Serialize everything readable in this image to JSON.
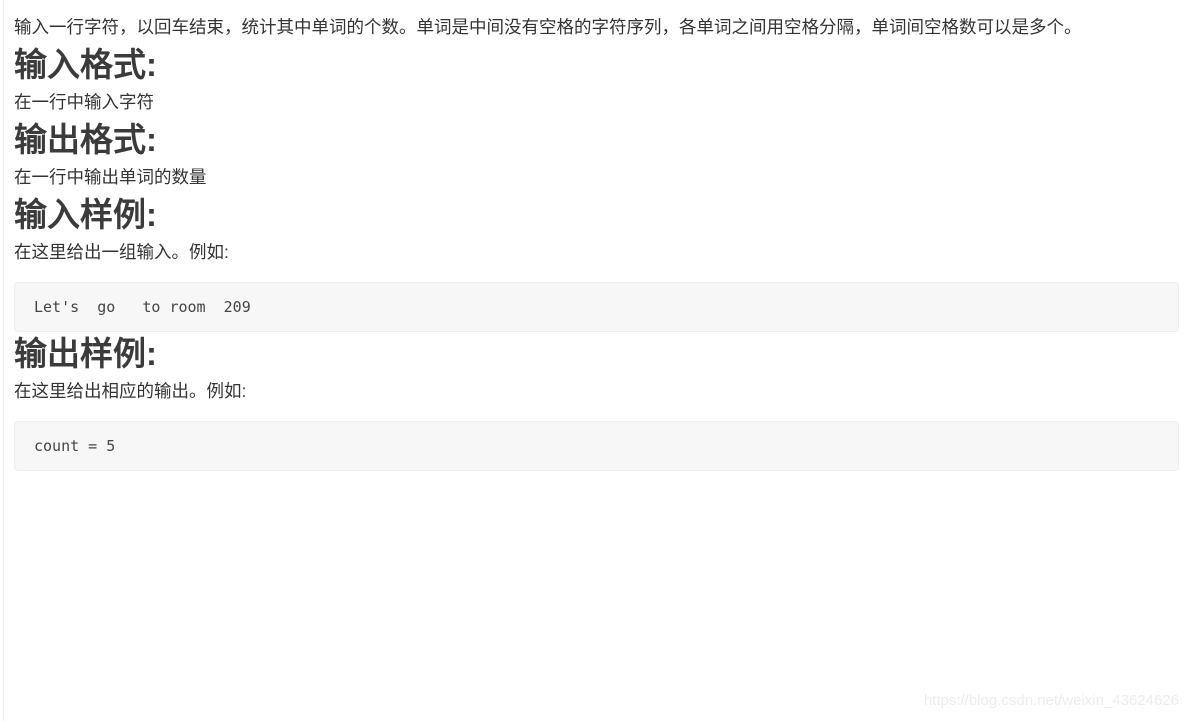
{
  "document": {
    "intro_paragraph": "输入一行字符，以回车结束，统计其中单词的个数。单词是中间没有空格的字符序列，各单词之间用空格分隔，单词间空格数可以是多个。",
    "sections": [
      {
        "heading": "输入格式:",
        "paragraph": "在一行中输入字符"
      },
      {
        "heading": "输出格式:",
        "paragraph": "在一行中输出单词的数量"
      },
      {
        "heading": "输入样例:",
        "paragraph": "在这里给出一组输入。例如:",
        "code": "Let's  go   to room  209"
      },
      {
        "heading": "输出样例:",
        "paragraph": "在这里给出相应的输出。例如:",
        "code": "count = 5"
      }
    ]
  },
  "watermark": {
    "text": "https://blog.csdn.net/weixin_43624626"
  },
  "colors": {
    "body_text": "#333333",
    "heading_text": "#3b3b3b",
    "code_background": "#f7f7f7",
    "code_border": "#eeeeee",
    "code_text": "#444444",
    "watermark_text": "#ececec",
    "page_background": "#ffffff"
  }
}
